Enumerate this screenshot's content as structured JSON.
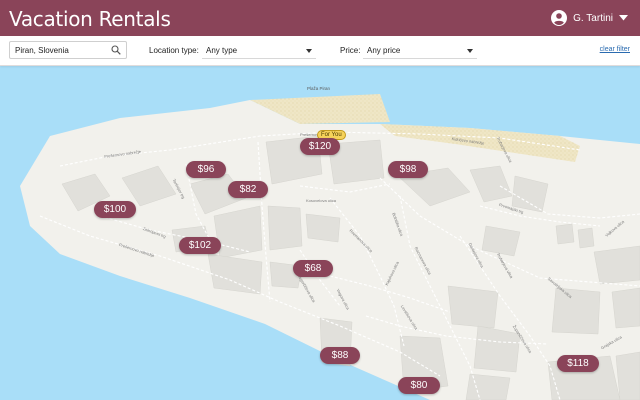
{
  "header": {
    "app_title": "Vacation Rentals",
    "user_name": "G. Tartini",
    "user_icon": "account-circle-icon",
    "caret_icon": "chevron-down-icon",
    "background": "#8a4459"
  },
  "filters": {
    "search_value": "Piran, Slovenia",
    "search_icon": "search-icon",
    "location_type_label": "Location type:",
    "location_type_value": "Any type",
    "price_label": "Price:",
    "price_value": "Any price",
    "clear_label": "clear filter"
  },
  "map": {
    "place_labels": {
      "square": "Plaža Piran",
      "street_top": "Prešernovo nabrežje",
      "street_a": "Prešernovo nabrežje",
      "street_b": "Tartinijev trg",
      "street_c": "Kidričevo nabrežje",
      "street_d": "Kosovelova ulica",
      "street_e": "Prešernovo nabrežje",
      "street_f": "Zelenjavni trg",
      "street_g": "Rozmanova ulica",
      "street_h": "Bolniška ulica",
      "street_i": "Gregorčičeva ulica",
      "street_j": "Trubarjeva ulica",
      "street_k": "Vegova ulica",
      "street_l": "Kajuhova ulica",
      "street_m": "Rozmanova ulica",
      "street_n": "Dantejeva ulica",
      "street_o": "Prvomajski trg",
      "street_p": "Savudrijska ulica",
      "street_q": "Vojkova ulica",
      "street_r": "Grajska ulica",
      "street_s": "Trubarjeva ulica",
      "street_t": "Levstikova ulica",
      "street_u": "Župančičeva ulica"
    },
    "for_you_label": "For You",
    "prices": {
      "p120": "$120",
      "p96": "$96",
      "p82": "$82",
      "p98": "$98",
      "p100": "$100",
      "p102": "$102",
      "p68": "$68",
      "p88": "$88",
      "p80": "$80",
      "p118": "$118"
    },
    "colors": {
      "sea": "#a9def8",
      "land": "#f2f1ec",
      "building": "#e1e0db",
      "beach": "#efe6c6",
      "marker": "#8a4459"
    }
  }
}
